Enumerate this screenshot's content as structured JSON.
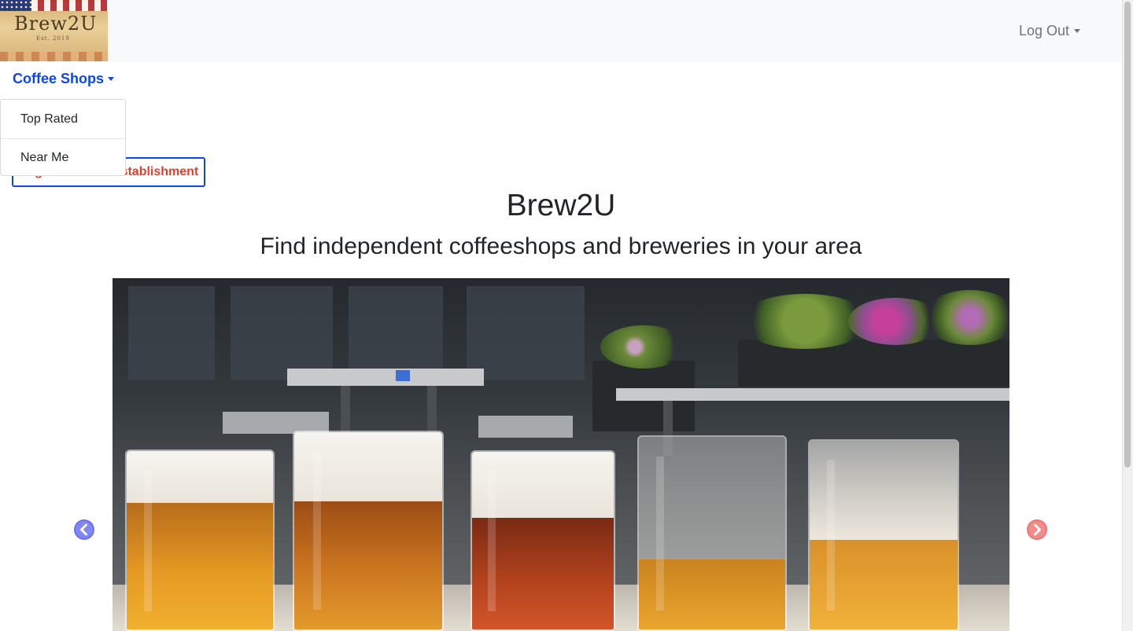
{
  "navbar": {
    "logo": {
      "text": "Brew2U",
      "sub": "Est. 2019"
    },
    "logout_label": "Log Out"
  },
  "nav": {
    "coffee_shops_label": "Coffee Shops",
    "dropdown": {
      "items": [
        {
          "label": "Top Rated"
        },
        {
          "label": "Near Me"
        }
      ]
    },
    "register_label": "Register a New Establishment"
  },
  "hero": {
    "title": "Brew2U",
    "subtitle": "Find independent coffeeshops and breweries in your area"
  },
  "carousel": {
    "image_alt": "five glasses of beer on an outdoor table",
    "prev_icon": "chevron-left-icon",
    "next_icon": "chevron-right-icon"
  },
  "colors": {
    "navbar_bg": "#f8f9fa",
    "link_blue": "#0d47e8",
    "register_red": "#e0402b",
    "prev_arrow": "#5b63f0",
    "next_arrow": "#f07070"
  }
}
